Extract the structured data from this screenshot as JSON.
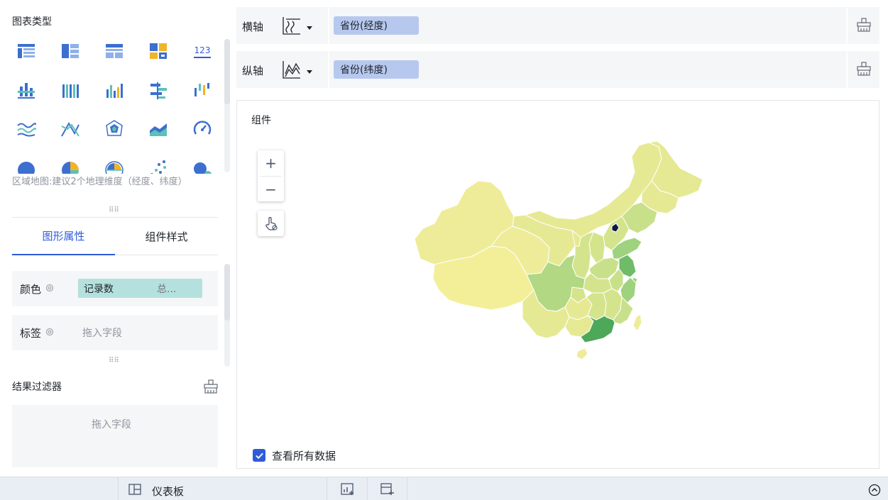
{
  "left_panel": {
    "chart_types_title": "图表类型",
    "chart_type_icons": [
      "cross-table-icon",
      "detail-table-icon",
      "group-table-icon",
      "kpi-card-icon",
      "number-card-icon",
      "stacked-bar-icon",
      "grouped-column-icon",
      "column-chart-icon",
      "bar-chart-icon",
      "range-column-icon",
      "wave-line-icon",
      "cross-line-icon",
      "radar-chart-icon",
      "area-chart-icon",
      "gauge-icon",
      "pie-chart-icon",
      "donut-segment-icon",
      "rose-chart-icon",
      "scatter-chart-icon",
      "bubble-chart-icon"
    ],
    "number_card_text": "123",
    "hint": "区域地图:建议2个地理维度（经度、纬度）",
    "tabs": [
      {
        "label": "图形属性",
        "active": true
      },
      {
        "label": "组件样式",
        "active": false
      }
    ],
    "color_row": {
      "label": "颜色",
      "field": "记录数",
      "aggregation": "总..."
    },
    "label_row": {
      "label": "标签",
      "placeholder": "拖入字段"
    },
    "filter": {
      "title": "结果过滤器",
      "placeholder": "拖入字段"
    }
  },
  "axes": {
    "x": {
      "label": "横轴",
      "field": "省份(经度)"
    },
    "y": {
      "label": "纵轴",
      "field": "省份(纬度)"
    }
  },
  "canvas": {
    "title": "组件",
    "zoom_in": "+",
    "zoom_out": "−",
    "view_all_label": "查看所有数据",
    "view_all_checked": true
  },
  "bottom_bar": {
    "dashboard_label": "仪表板"
  },
  "colors": {
    "accent": "#2f5bd9",
    "map_light": "#f3ef98",
    "map_mid": "#d4e48c",
    "map_green": "#9fd27e",
    "map_dark": "#4ea85a",
    "map_beijing": "#0f1445",
    "color_pill": "#b4e1dd",
    "axis_pill": "#b7c8ef"
  }
}
